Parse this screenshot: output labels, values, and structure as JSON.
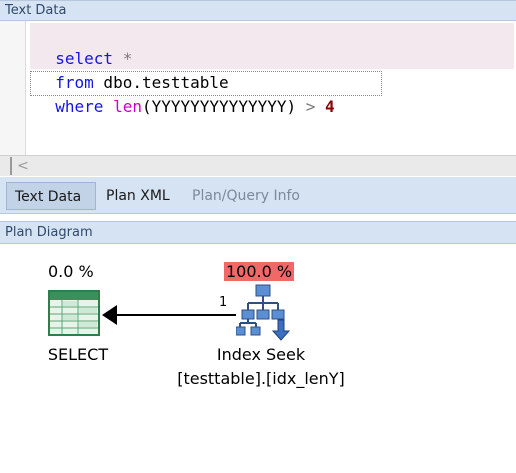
{
  "text_data_panel": {
    "title": "Text Data",
    "code": {
      "line1": {
        "kw": "select",
        "rest": " *"
      },
      "line2": {
        "kw": "from",
        "rest": " dbo.testtable"
      },
      "line3": {
        "kw": "where",
        "fn": "len",
        "args": "(YYYYYYYYYYYYYY)",
        "op": "> ",
        "num": "4"
      }
    },
    "scroll_left_glyph": "<"
  },
  "tabs": [
    {
      "label": "Text Data",
      "active": true
    },
    {
      "label": "Plan XML",
      "active": false
    },
    {
      "label": "Plan/Query Info",
      "active": false
    }
  ],
  "plan_diagram_panel": {
    "title": "Plan Diagram",
    "operators": [
      {
        "cost": "0.0 %",
        "label": "SELECT",
        "icon": "result-grid-icon"
      },
      {
        "cost": "100.0 %",
        "label": "Index Seek",
        "object": "[testtable].[idx_lenY]",
        "icon": "index-seek-icon",
        "cost_highlight": "#f06868"
      }
    ],
    "edge": {
      "rows": "1"
    }
  },
  "colors": {
    "header_bg": "#d6e3f2",
    "keyword": "#1414e8",
    "function": "#c800c8",
    "number": "#8b0000",
    "selection_bg": "#f4e8ef"
  }
}
